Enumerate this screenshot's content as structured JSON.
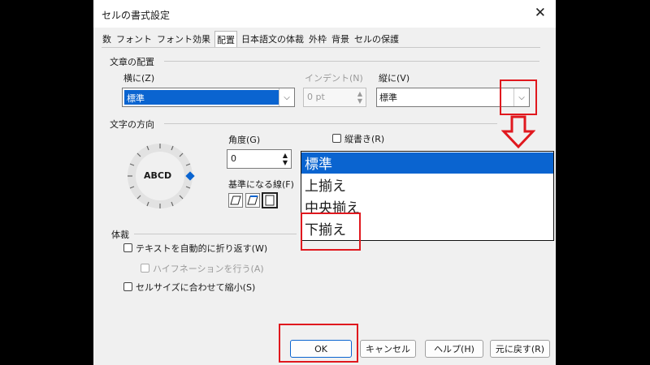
{
  "dialog": {
    "title": "セルの書式設定",
    "close_glyph": "✕"
  },
  "tabs": [
    "数",
    "フォント",
    "フォント効果",
    "配置",
    "日本語文の体裁",
    "外枠",
    "背景",
    "セルの保護"
  ],
  "active_tab_index": 3,
  "text_alignment": {
    "section_title": "文章の配置",
    "horizontal_label": "横に(Z)",
    "horizontal_value": "標準",
    "indent_label": "インデント(N)",
    "indent_value": "0 pt",
    "vertical_label": "縦に(V)",
    "vertical_value": "標準"
  },
  "text_orientation": {
    "section_title": "文字の方向",
    "dial_text": "ABCD",
    "angle_label": "角度(G)",
    "angle_value": "0",
    "vertical_stacking_label": "縦書き(R)",
    "reference_edge_label": "基準になる線(F)"
  },
  "properties": {
    "section_title": "体裁",
    "wrap_text_label": "テキストを自動的に折り返す(W)",
    "hyphenation_label": "ハイフネーションを行う(A)",
    "shrink_label": "セルサイズに合わせて縮小(S)"
  },
  "vertical_dropdown": {
    "options": [
      "標準",
      "上揃え",
      "中央揃え",
      "下揃え"
    ],
    "selected_index": 0
  },
  "buttons": {
    "ok": "OK",
    "cancel": "キャンセル",
    "help": "ヘルプ(H)",
    "reset": "元に戻す(R)"
  },
  "annotation_color": "#e0181e",
  "accent_color": "#0a64d0"
}
